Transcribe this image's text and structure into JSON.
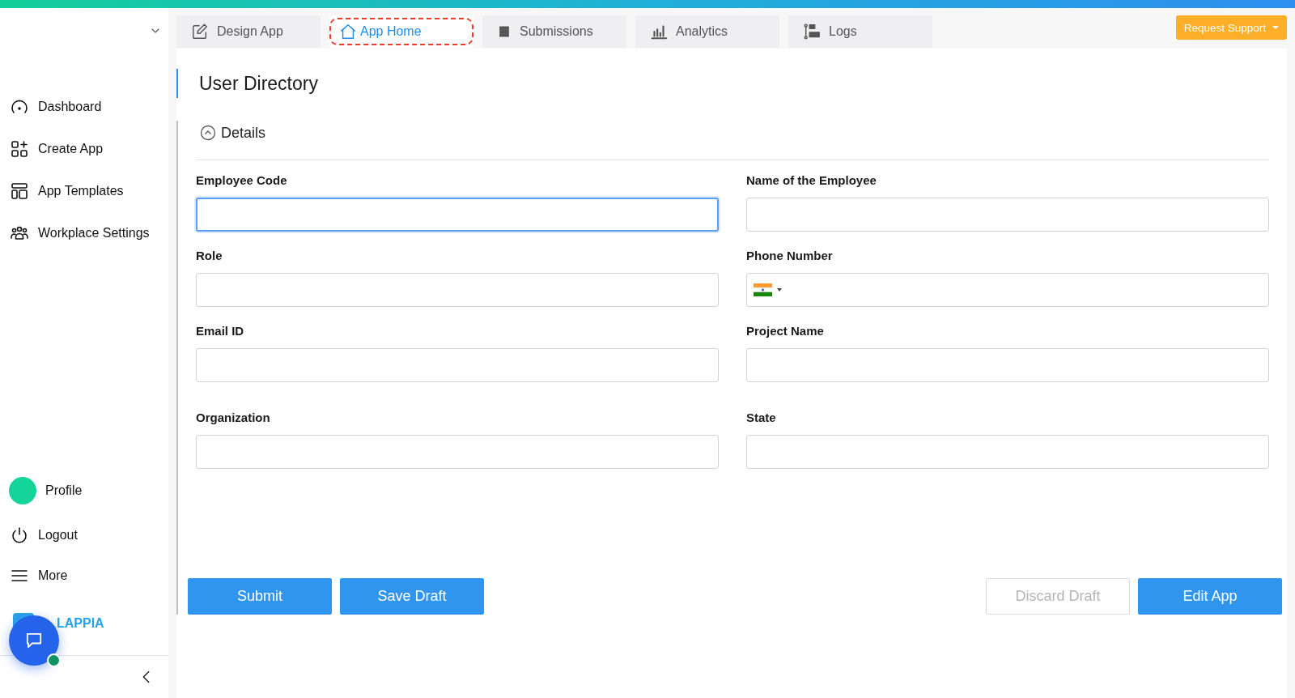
{
  "sidebar": {
    "items": [
      {
        "label": "Dashboard",
        "kind": "dashboard"
      },
      {
        "label": "Create App",
        "kind": "create"
      },
      {
        "label": "App Templates",
        "kind": "templates"
      },
      {
        "label": "Workplace Settings",
        "kind": "people"
      }
    ],
    "bottom_items": [
      {
        "label": "Profile",
        "kind": "profile"
      },
      {
        "label": "Logout",
        "kind": "logout"
      },
      {
        "label": "More",
        "kind": "more"
      }
    ],
    "logo": "LAPPIA"
  },
  "tabs": [
    {
      "label": "Design App",
      "kind": "edit",
      "selected": false
    },
    {
      "label": "App Home",
      "kind": "home",
      "selected": true
    },
    {
      "label": "Submissions",
      "kind": "list",
      "selected": false
    },
    {
      "label": "Analytics",
      "kind": "chart",
      "selected": false
    },
    {
      "label": "Logs",
      "kind": "logs",
      "selected": false
    }
  ],
  "support_button": "Request Support",
  "page_title": "User Directory",
  "section": {
    "title": "Details",
    "expanded": true
  },
  "fields": [
    {
      "label": "Employee Code",
      "kind": "text",
      "focused": true
    },
    {
      "label": "Name of the Employee",
      "kind": "text",
      "focused": false
    },
    {
      "label": "Role",
      "kind": "text",
      "focused": false
    },
    {
      "label": "Phone Number",
      "kind": "phone",
      "focused": false
    },
    {
      "label": "Email ID",
      "kind": "text",
      "focused": false
    },
    {
      "label": "Project Name",
      "kind": "text",
      "focused": false
    },
    {
      "label": "Organization",
      "kind": "text",
      "focused": false
    },
    {
      "label": "State",
      "kind": "text",
      "focused": false
    }
  ],
  "buttons_left": [
    {
      "label": "Submit",
      "disabled": false
    },
    {
      "label": "Save Draft",
      "disabled": false
    }
  ],
  "buttons_right": [
    {
      "label": "Discard Draft",
      "disabled": true
    },
    {
      "label": "Edit App",
      "disabled": false
    }
  ]
}
